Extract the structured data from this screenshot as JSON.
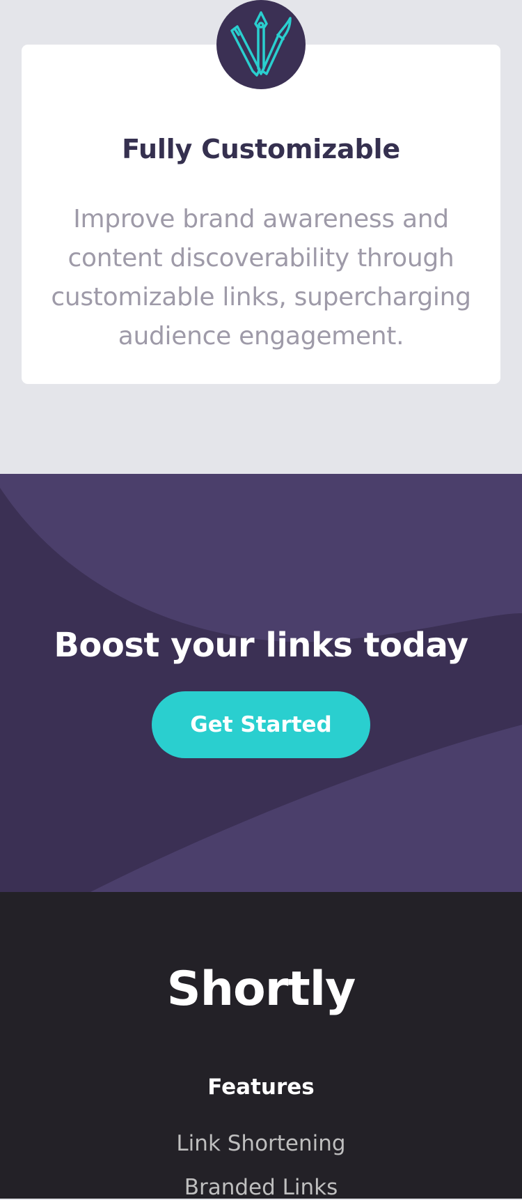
{
  "feature": {
    "icon": "pens-icon",
    "title": "Fully Customizable",
    "description": "Improve brand awareness and content discoverability through customizable links, supercharging audience engagement."
  },
  "boost": {
    "title": "Boost your links today",
    "button_label": "Get Started"
  },
  "footer": {
    "logo": "Shortly",
    "features_heading": "Features",
    "links": [
      "Link Shortening",
      "Branded Links"
    ]
  },
  "colors": {
    "page_background": "#e4e5ea",
    "card_background": "#ffffff",
    "dark_violet": "#3b3054",
    "violet_light": "#4b3f6b",
    "cyan": "#2acfcf",
    "footer_background": "#232127",
    "heading_text": "#35304f",
    "body_text": "#9e9aa8"
  }
}
